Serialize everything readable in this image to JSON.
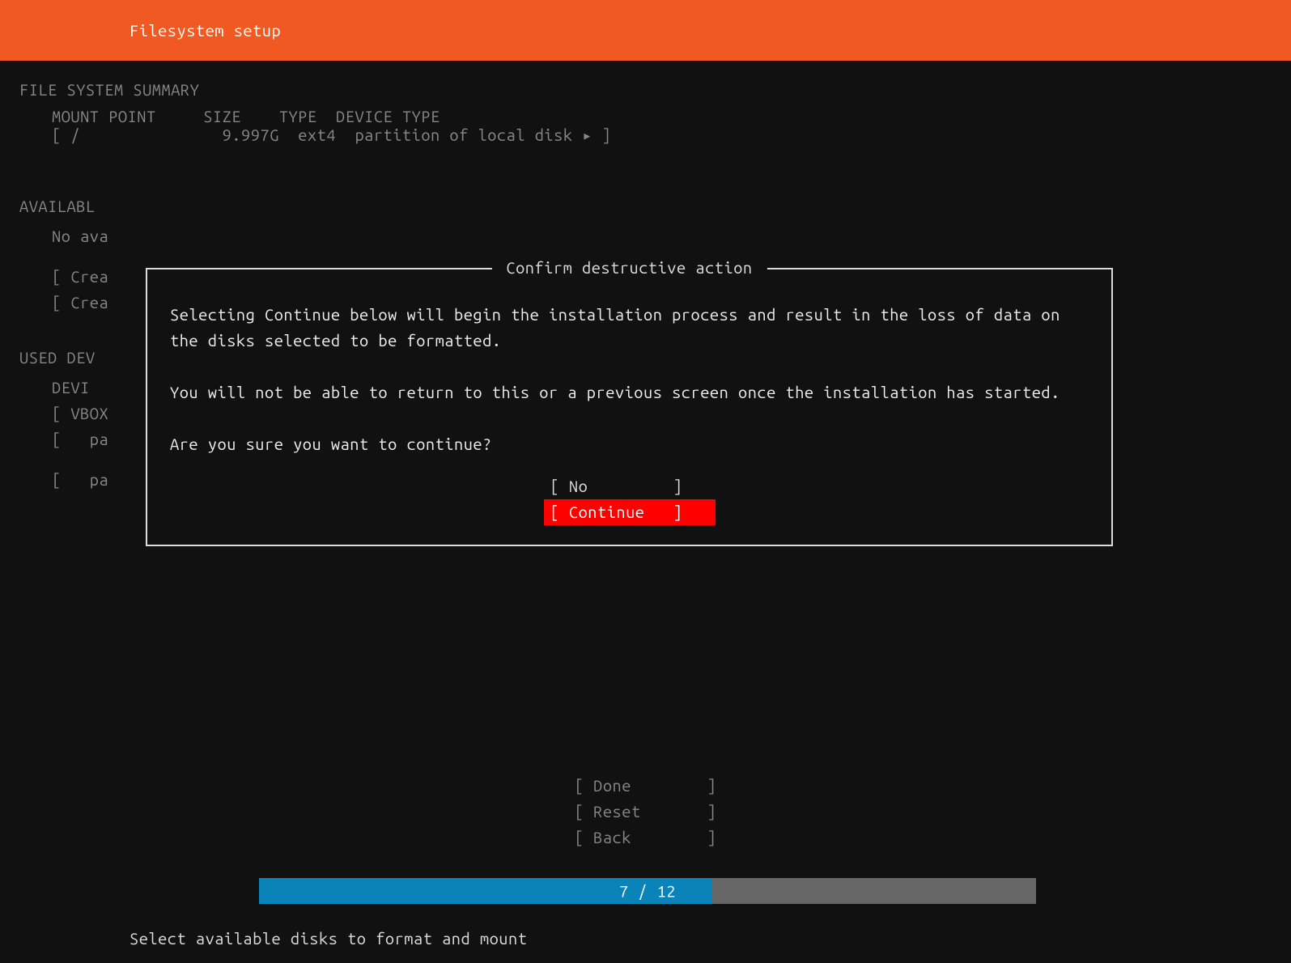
{
  "header": {
    "title": "Filesystem setup"
  },
  "summary": {
    "title": "FILE SYSTEM SUMMARY",
    "headers": {
      "mount": "MOUNT POINT",
      "size": "SIZE",
      "type": "TYPE",
      "devtype": "DEVICE TYPE"
    },
    "row": {
      "bracket_open": "[",
      "mount": "/",
      "size": "9.997G",
      "type": "ext4",
      "devtype": "partition of local disk",
      "arrow": "▸",
      "bracket_close": "]"
    }
  },
  "available": {
    "title": "AVAILABL",
    "no_ava": "No ava",
    "crea1": "[ Crea",
    "crea2": "[ Crea"
  },
  "used": {
    "title": "USED DEV",
    "devi": "DEVI",
    "vbox": "[ VBOX",
    "pa1": "[   pa",
    "pa2": "[   pa"
  },
  "dialog": {
    "title": "Confirm destructive action",
    "p1": "Selecting Continue below will begin the installation process and result in the loss of data on the disks selected to be formatted.",
    "p2": "You will not be able to return to this or a previous screen once the installation has started.",
    "p3": "Are you sure you want to continue?",
    "no_label": "[ No         ]",
    "continue_label": "[ Continue   ]"
  },
  "bottom": {
    "done": "[ Done        ]",
    "reset": "[ Reset       ]",
    "back": "[ Back        ]"
  },
  "progress": {
    "current": "7",
    "total": "12",
    "text": "7 / 12"
  },
  "footer": {
    "hint": "Select available disks to format and mount"
  }
}
